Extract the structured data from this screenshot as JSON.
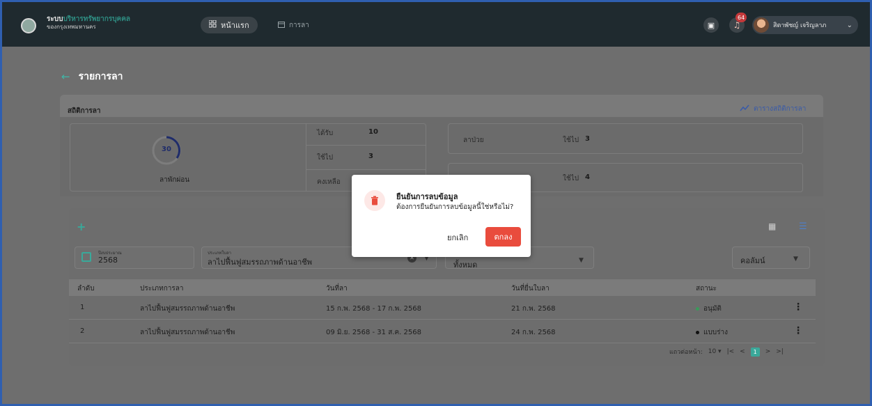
{
  "app": {
    "brand_title_part1": "ระบบ",
    "brand_title_part2": "บริหารทรัพยากรบุคคล",
    "brand_subtitle": "ของกรุงเทพมหานคร",
    "nav_home": "หน้าแรก",
    "nav_leave": "การลา",
    "notification_count": "64",
    "user_name": "สิตาพัชญ์ เจริญลาภ"
  },
  "page": {
    "title": "รายการลา"
  },
  "stats": {
    "title": "สถิติการลา",
    "link_label": "ตารางสถิติการลา",
    "annual": {
      "total": "30",
      "label": "ลาพักผ่อน",
      "received_label": "ได้รับ",
      "received_value": "10",
      "used_label": "ใช้ไป",
      "used_value": "3",
      "remaining_label": "คงเหลือ"
    },
    "sick": {
      "label": "ลาป่วย",
      "used_label": "ใช้ไป",
      "used_value": "3"
    },
    "other": {
      "used_label": "ใช้ไป",
      "used_value": "4"
    }
  },
  "filters": {
    "year_label": "ปีงบประมาณ",
    "year_value": "2568",
    "type_label": "ประเภทใบลา",
    "type_value": "ลาไปฟื้นฟูสมรรถภาพด้านอาชีพ",
    "status_value": "ทั้งหมด",
    "columns_label": "คอลัมน์"
  },
  "table": {
    "headers": [
      "ลำดับ",
      "ประเภทการลา",
      "วันที่ลา",
      "วันที่ยื่นใบลา",
      "สถานะ"
    ],
    "rows": [
      {
        "no": "1",
        "type": "ลาไปฟื้นฟูสมรรถภาพด้านอาชีพ",
        "dates": "15 ก.พ. 2568 - 17 ก.พ. 2568",
        "submitted": "21 ก.พ. 2568",
        "status": "อนุมัติ",
        "status_color": "#3a9a5a"
      },
      {
        "no": "2",
        "type": "ลาไปฟื้นฟูสมรรถภาพด้านอาชีพ",
        "dates": "09 มิ.ย. 2568 - 31 ส.ค. 2568",
        "submitted": "24 ก.พ. 2568",
        "status": "แบบร่าง",
        "status_color": "#111111"
      }
    ]
  },
  "pagination": {
    "rows_per_page_label": "แถวต่อหน้า:",
    "rows_per_page": "10",
    "current_page": "1"
  },
  "modal": {
    "title": "ยืนยันการลบข้อมูล",
    "message": "ต้องการยืนยันการลบข้อมูลนี้ใช่หรือไม่?",
    "cancel_label": "ยกเลิก",
    "ok_label": "ตกลง"
  },
  "colors": {
    "accent": "#3aa89a",
    "danger": "#e94c3d",
    "topbar": "#1f2a2f"
  }
}
